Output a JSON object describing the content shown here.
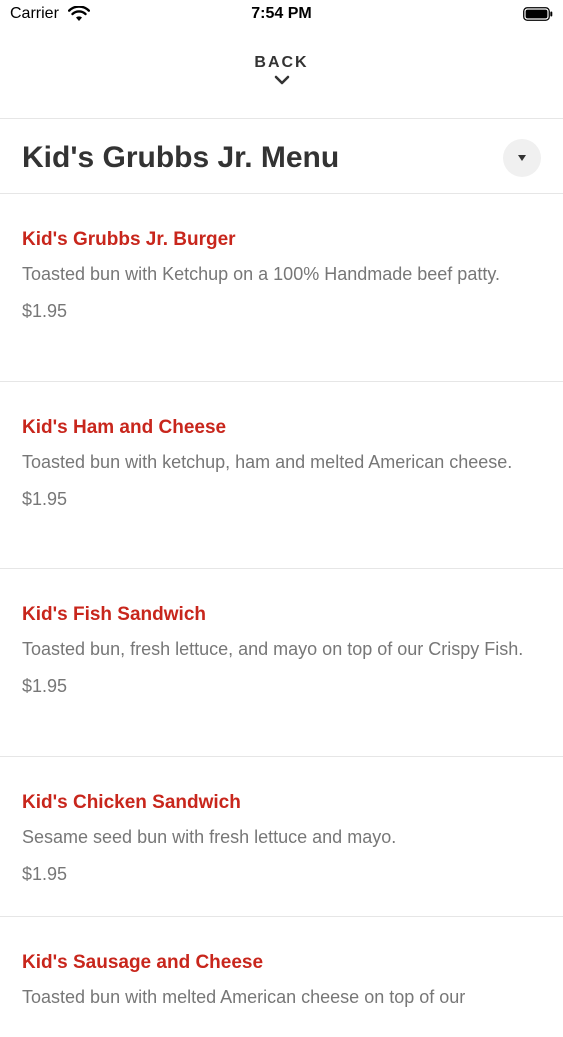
{
  "status_bar": {
    "carrier": "Carrier",
    "time": "7:54 PM"
  },
  "nav": {
    "back_label": "BACK"
  },
  "menu": {
    "title": "Kid's Grubbs Jr. Menu",
    "items": [
      {
        "name": "Kid's Grubbs Jr. Burger",
        "description": "Toasted bun with Ketchup on a 100% Handmade beef patty.",
        "price": "$1.95"
      },
      {
        "name": "Kid's Ham and Cheese",
        "description": "Toasted bun with ketchup, ham and melted American cheese.",
        "price": "$1.95"
      },
      {
        "name": "Kid's Fish Sandwich",
        "description": "Toasted bun, fresh lettuce, and mayo on top of our Crispy Fish.",
        "price": "$1.95"
      },
      {
        "name": "Kid's Chicken Sandwich",
        "description": "Sesame seed bun with fresh lettuce and mayo.",
        "price": "$1.95"
      },
      {
        "name": "Kid's Sausage and Cheese",
        "description": "Toasted bun with melted American cheese on top of our",
        "price": ""
      }
    ]
  },
  "colors": {
    "accent": "#c8261c",
    "text": "#333333",
    "muted": "#777777",
    "divider": "#e6e6e6"
  }
}
